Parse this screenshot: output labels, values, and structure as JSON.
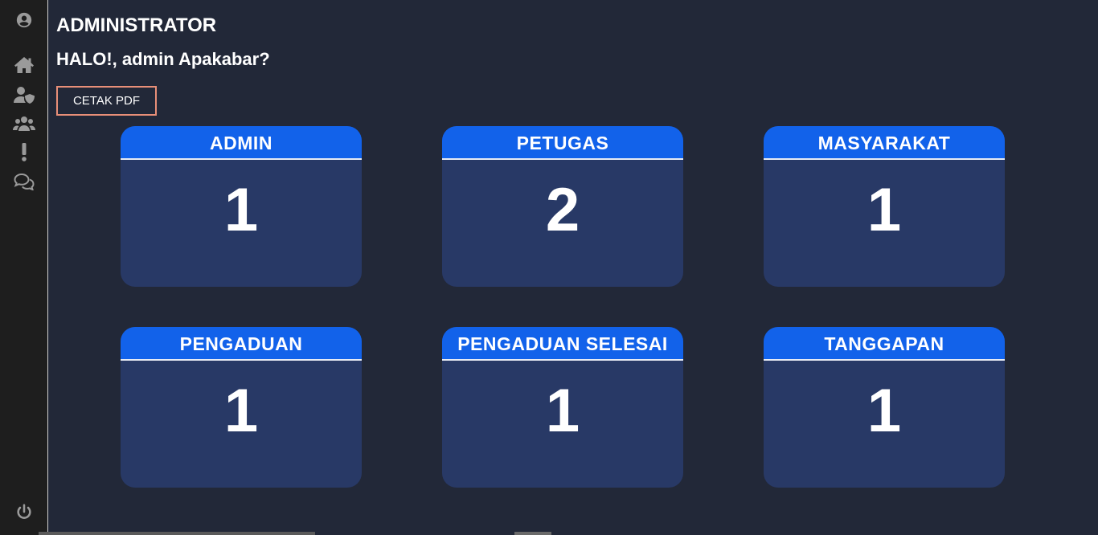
{
  "sidebar": {
    "items": [
      {
        "icon": "user-circle-icon"
      },
      {
        "icon": "home-icon"
      },
      {
        "icon": "user-shield-icon"
      },
      {
        "icon": "users-icon"
      },
      {
        "icon": "exclamation-icon"
      },
      {
        "icon": "comments-icon"
      },
      {
        "icon": "power-icon"
      }
    ]
  },
  "header": {
    "title": "ADMINISTRATOR",
    "greeting": "HALO!, admin Apakabar?",
    "pdf_button": "CETAK PDF"
  },
  "cards": [
    {
      "label": "ADMIN",
      "value": "1"
    },
    {
      "label": "PETUGAS",
      "value": "2"
    },
    {
      "label": "MASYARAKAT",
      "value": "1"
    },
    {
      "label": "PENGADUAN",
      "value": "1"
    },
    {
      "label": "PENGADUAN SELESAI",
      "value": "1"
    },
    {
      "label": "TANGGAPAN",
      "value": "1"
    }
  ],
  "colors": {
    "background": "#222838",
    "sidebar": "#1e1e1e",
    "card_body": "#283966",
    "card_header": "#1262ea",
    "button_border": "#e88f78"
  }
}
